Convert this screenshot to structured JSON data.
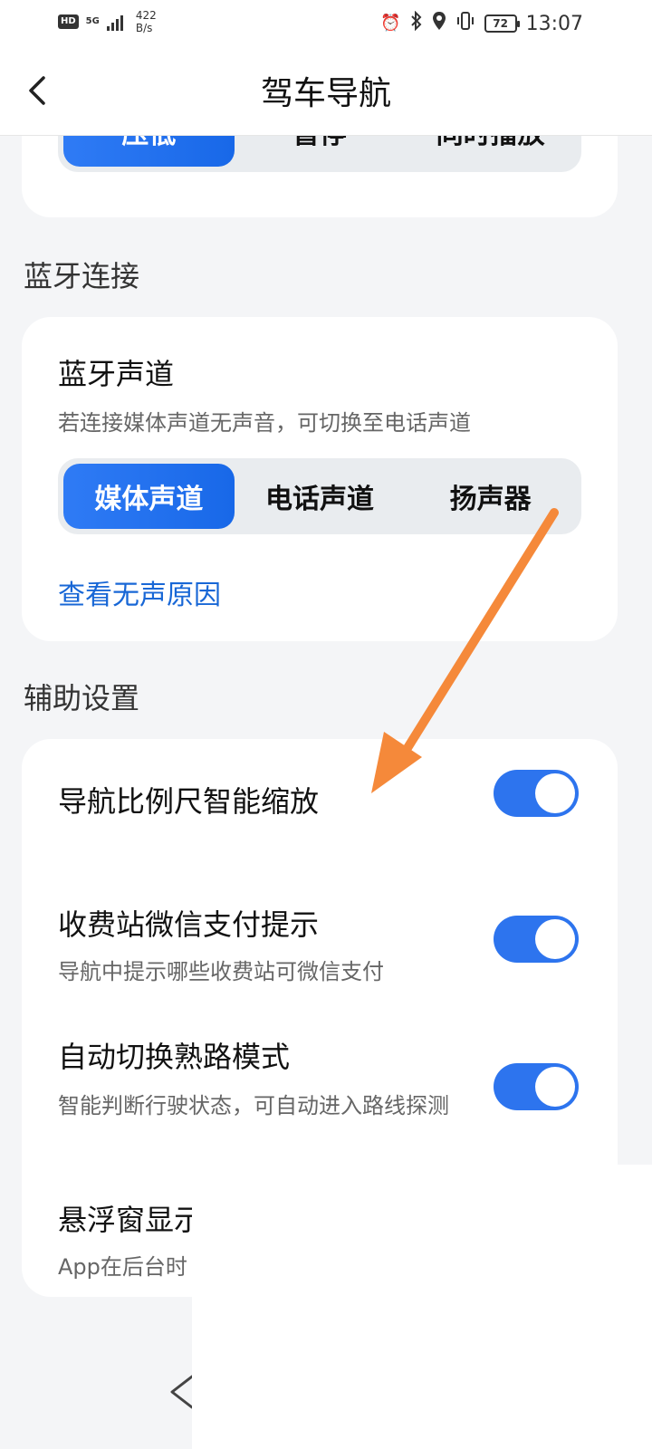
{
  "status_bar": {
    "hd": "HD",
    "net_type": "5G",
    "speed_value": "422",
    "speed_unit": "B/s",
    "battery": "72",
    "time": "13:07",
    "icons": [
      "alarm-icon",
      "bluetooth-icon",
      "location-icon",
      "vibrate-icon"
    ]
  },
  "header": {
    "title": "驾车导航"
  },
  "voice_mix": {
    "options": [
      "压低",
      "暂停",
      "同时播放"
    ],
    "selected_index": 0
  },
  "bluetooth": {
    "section_title": "蓝牙连接",
    "channel_title": "蓝牙声道",
    "channel_desc": "若连接媒体声道无声音，可切换至电话声道",
    "options": [
      "媒体声道",
      "电话声道",
      "扬声器"
    ],
    "selected_index": 0,
    "link_label": "查看无声原因"
  },
  "aux": {
    "section_title": "辅助设置",
    "items": [
      {
        "title": "导航比例尺智能缩放",
        "desc": "",
        "enabled": true
      },
      {
        "title": "收费站微信支付提示",
        "desc": "导航中提示哪些收费站可微信支付",
        "enabled": true
      },
      {
        "title": "自动切换熟路模式",
        "desc": "智能判断行驶状态，可自动进入路线探测",
        "enabled": true
      },
      {
        "title": "悬浮窗显示",
        "desc": "App在后台时"
      }
    ]
  },
  "colors": {
    "accent": "#2d74ee",
    "link": "#1867d6",
    "annotation_arrow": "#f5893a"
  }
}
